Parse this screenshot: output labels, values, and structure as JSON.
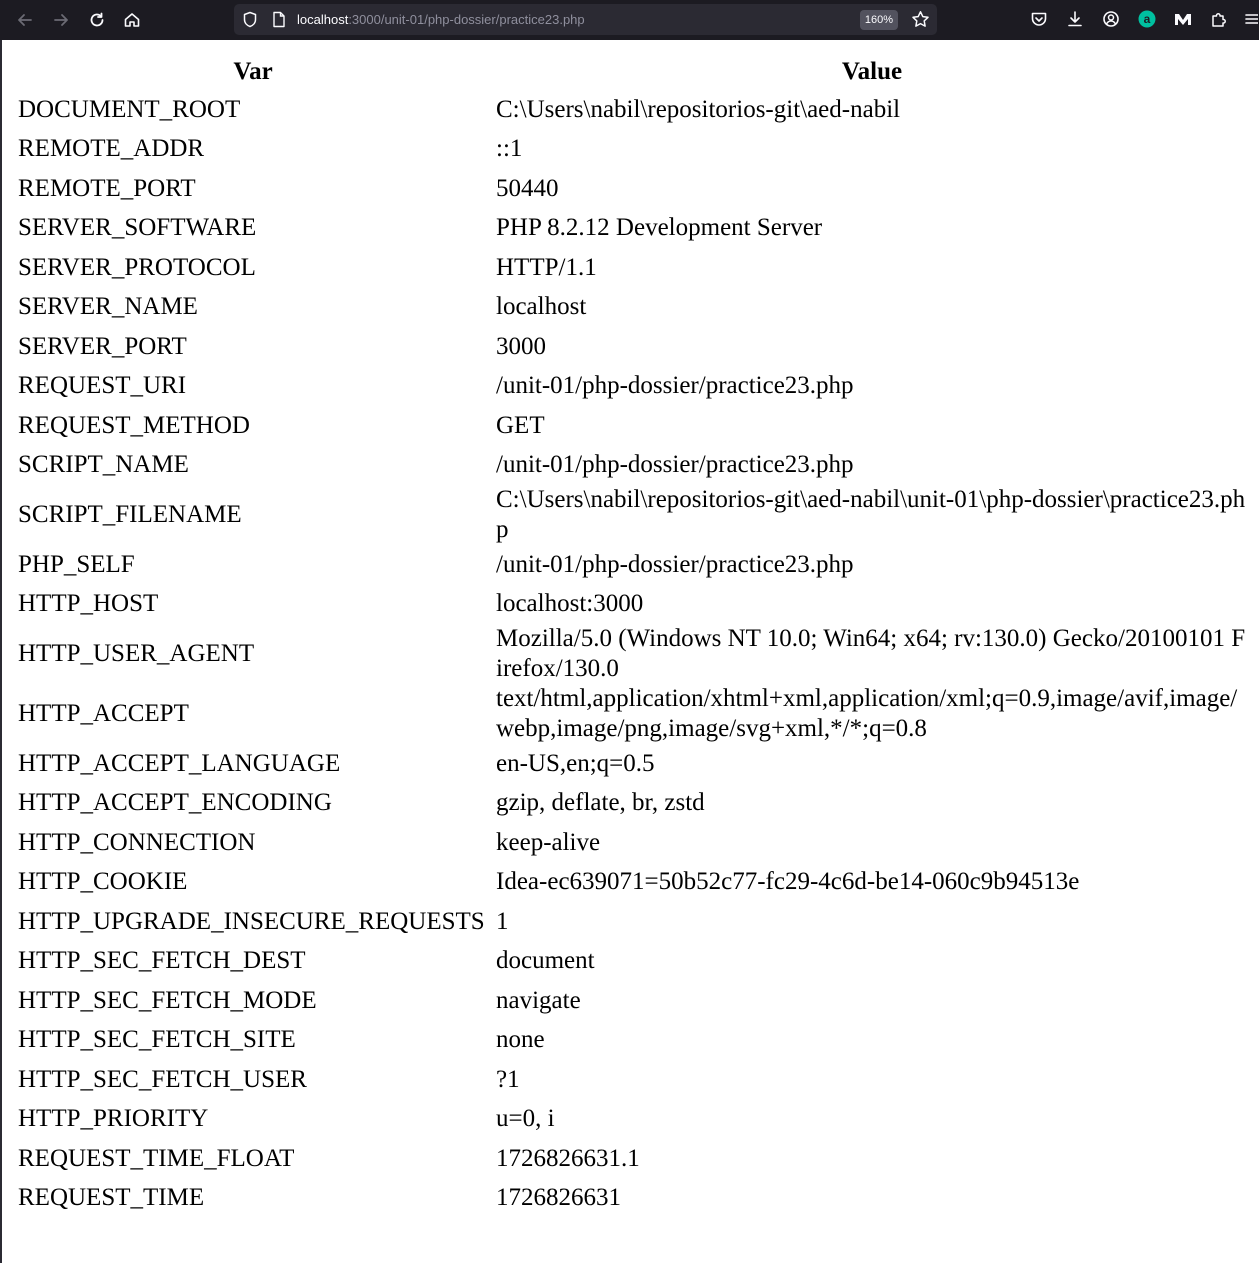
{
  "browser": {
    "url_host": "localhost",
    "url_path": ":3000/unit-01/php-dossier/practice23.php",
    "zoom": "160%",
    "colors": {
      "toolbar": "#1c1b22",
      "urlbar": "#2b2a33",
      "accent": "#00c0a0"
    },
    "icons": {
      "back": "back-arrow-icon",
      "forward": "forward-arrow-icon",
      "reload": "reload-icon",
      "home": "home-icon",
      "shield": "shield-icon",
      "page": "page-icon",
      "bookmark": "star-icon",
      "pocket": "pocket-icon",
      "downloads": "download-icon",
      "account": "account-icon",
      "ext_a": "extension-a-icon",
      "ext_m": "extension-m-icon",
      "extensions": "puzzle-icon",
      "menu": "hamburger-menu-icon"
    }
  },
  "table": {
    "headers": [
      "Var",
      "Value"
    ],
    "rows": [
      {
        "var": "DOCUMENT_ROOT",
        "value": "C:\\Users\\nabil\\repositorios-git\\aed-nabil"
      },
      {
        "var": "REMOTE_ADDR",
        "value": "::1"
      },
      {
        "var": "REMOTE_PORT",
        "value": "50440"
      },
      {
        "var": "SERVER_SOFTWARE",
        "value": "PHP 8.2.12 Development Server"
      },
      {
        "var": "SERVER_PROTOCOL",
        "value": "HTTP/1.1"
      },
      {
        "var": "SERVER_NAME",
        "value": "localhost"
      },
      {
        "var": "SERVER_PORT",
        "value": "3000"
      },
      {
        "var": "REQUEST_URI",
        "value": "/unit-01/php-dossier/practice23.php"
      },
      {
        "var": "REQUEST_METHOD",
        "value": "GET"
      },
      {
        "var": "SCRIPT_NAME",
        "value": "/unit-01/php-dossier/practice23.php"
      },
      {
        "var": "SCRIPT_FILENAME",
        "value": "C:\\Users\\nabil\\repositorios-git\\aed-nabil\\unit-01\\php-dossier\\practice23.php"
      },
      {
        "var": "PHP_SELF",
        "value": "/unit-01/php-dossier/practice23.php"
      },
      {
        "var": "HTTP_HOST",
        "value": "localhost:3000"
      },
      {
        "var": "HTTP_USER_AGENT",
        "value": "Mozilla/5.0 (Windows NT 10.0; Win64; x64; rv:130.0) Gecko/20100101 Firefox/130.0"
      },
      {
        "var": "HTTP_ACCEPT",
        "value": "text/html,application/xhtml+xml,application/xml;q=0.9,image/avif,image/webp,image/png,image/svg+xml,*/*;q=0.8"
      },
      {
        "var": "HTTP_ACCEPT_LANGUAGE",
        "value": "en-US,en;q=0.5"
      },
      {
        "var": "HTTP_ACCEPT_ENCODING",
        "value": "gzip, deflate, br, zstd"
      },
      {
        "var": "HTTP_CONNECTION",
        "value": "keep-alive"
      },
      {
        "var": "HTTP_COOKIE",
        "value": "Idea-ec639071=50b52c77-fc29-4c6d-be14-060c9b94513e"
      },
      {
        "var": "HTTP_UPGRADE_INSECURE_REQUESTS",
        "value": "1"
      },
      {
        "var": "HTTP_SEC_FETCH_DEST",
        "value": "document"
      },
      {
        "var": "HTTP_SEC_FETCH_MODE",
        "value": "navigate"
      },
      {
        "var": "HTTP_SEC_FETCH_SITE",
        "value": "none"
      },
      {
        "var": "HTTP_SEC_FETCH_USER",
        "value": "?1"
      },
      {
        "var": "HTTP_PRIORITY",
        "value": "u=0, i"
      },
      {
        "var": "REQUEST_TIME_FLOAT",
        "value": "1726826631.1"
      },
      {
        "var": "REQUEST_TIME",
        "value": "1726826631"
      }
    ]
  }
}
